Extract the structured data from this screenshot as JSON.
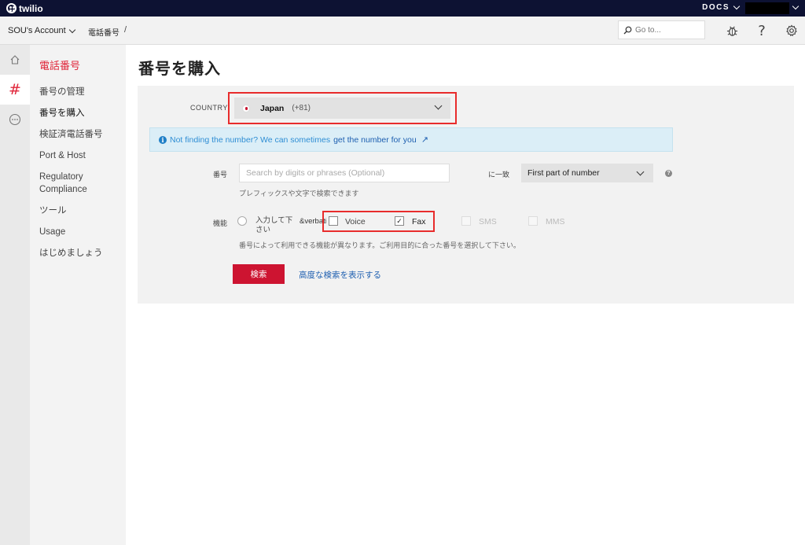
{
  "topbar": {
    "logo_text": "twilio",
    "docs_label": "DOCS"
  },
  "subheader": {
    "account_label": "SOU's Account",
    "breadcrumb": "電話番号",
    "breadcrumb_sep": "/",
    "search_placeholder": "Go to..."
  },
  "icons": {
    "rail": [
      "home-icon",
      "hash-icon",
      "more-icon"
    ],
    "header": [
      "debugger-icon",
      "help-icon",
      "settings-icon"
    ]
  },
  "sidenav": {
    "title": "電話番号",
    "items": [
      "番号の管理",
      "番号を購入",
      "検証済電話番号",
      "Port & Host",
      "Regulatory Compliance",
      "ツール",
      "Usage",
      "はじめましょう"
    ]
  },
  "main": {
    "title": "番号を購入",
    "country_label": "COUNTRY",
    "country_name": "Japan",
    "country_code": "(+81)",
    "info_text": "Not finding the number? We can sometimes",
    "info_link": "get the number for you",
    "number_label": "番号",
    "number_placeholder": "Search by digits or phrases (Optional)",
    "number_hint": "プレフィックスや文字で検索できます",
    "match_label": "に一致",
    "match_value": "First part of number",
    "capability_label": "機能",
    "radio_label": "入力して下さい",
    "verbatim_text": "&verbatim",
    "capabilities": [
      {
        "label": "Voice",
        "checked": false,
        "enabled": true
      },
      {
        "label": "Fax",
        "checked": true,
        "enabled": true
      },
      {
        "label": "SMS",
        "checked": false,
        "enabled": false
      },
      {
        "label": "MMS",
        "checked": false,
        "enabled": false
      }
    ],
    "capability_hint": "番号によって利用できる機能が異なります。ご利用目的に合った番号を選択して下さい。",
    "search_button": "検索",
    "advanced_link": "高度な検索を表示する"
  },
  "colors": {
    "brand_red": "#cd1431",
    "highlight_red": "#e82c2c",
    "topbar_navy": "#0d1233",
    "link_blue": "#1e5fb0"
  }
}
